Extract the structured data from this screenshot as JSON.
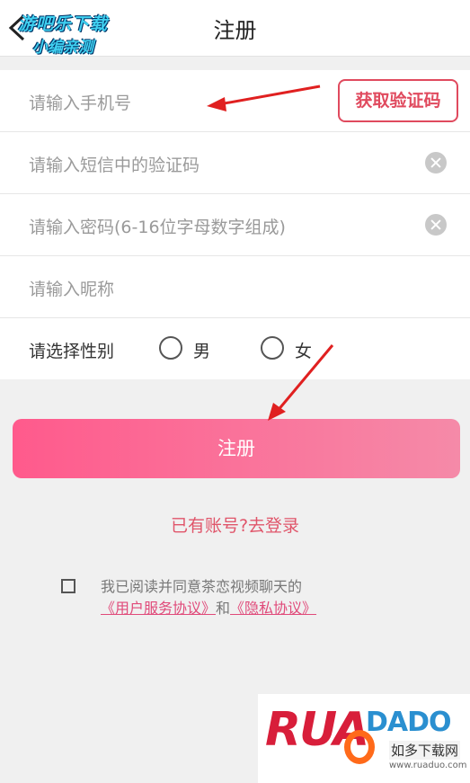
{
  "header": {
    "title": "注册",
    "watermark_line1": "游吧乐下载",
    "watermark_line2": "小编亲测"
  },
  "form": {
    "phone_placeholder": "请输入手机号",
    "code_button": "获取验证码",
    "sms_placeholder": "请输入短信中的验证码",
    "password_placeholder": "请输入密码(6-16位字母数字组成)",
    "nickname_placeholder": "请输入昵称",
    "gender_label": "请选择性别",
    "gender_male": "男",
    "gender_female": "女"
  },
  "submit_label": "注册",
  "login_link": "已有账号?去登录",
  "agreement": {
    "text": "我已阅读并同意茶恋视频聊天的",
    "link1": "《用户服务协议》",
    "and": "和",
    "link2": "《隐私协议》"
  },
  "corner_logo": {
    "text": "RUA",
    "text2": "DADO",
    "cn": "如多下载网",
    "url": "www.ruaduo.com"
  },
  "colors": {
    "accent": "#e04a5e",
    "button_gradient_start": "#ff5a8c",
    "button_gradient_end": "#f58aa8",
    "background": "#f0f0f0"
  }
}
